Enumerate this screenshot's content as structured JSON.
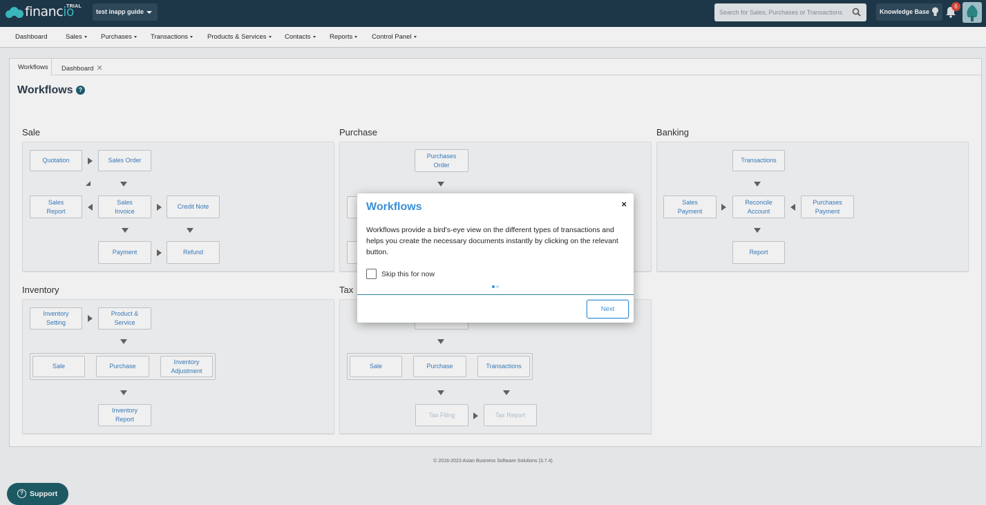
{
  "app": {
    "logo": "financio",
    "trial_label": "TRIAL",
    "company_selector": "test inapp guide",
    "search_placeholder": "Search for Sales, Purchases or Transactions",
    "knowledge_base": "Knowledge Base",
    "notification_count": "6"
  },
  "nav": [
    "Dashboard",
    "Sales",
    "Purchases",
    "Transactions",
    "Products & Services",
    "Contacts",
    "Reports",
    "Control Panel"
  ],
  "tabs": {
    "workflows": "Workflows",
    "dashboard": "Dashboard"
  },
  "page": {
    "title": "Workflows",
    "help": "?"
  },
  "sections": {
    "sale": {
      "title": "Sale",
      "quotation": "Quotation",
      "sales_order": "Sales Order",
      "sales_report": "Sales\nReport",
      "sales_invoice": "Sales\nInvoice",
      "credit_note": "Credit Note",
      "payment": "Payment",
      "refund": "Refund"
    },
    "purchase": {
      "title": "Purchase",
      "purchases_order": "Purchases\nOrder"
    },
    "banking": {
      "title": "Banking",
      "transactions": "Transactions",
      "sales_payment": "Sales\nPayment",
      "reconcile_account": "Reconcile\nAccount",
      "purchases_payment": "Purchases\nPayment",
      "report": "Report"
    },
    "inventory": {
      "title": "Inventory",
      "inventory_setting": "Inventory\nSetting",
      "product_service": "Product &\nService",
      "sale": "Sale",
      "purchase": "Purchase",
      "inventory_adjustment": "Inventory\nAdjustment",
      "inventory_report": "Inventory\nReport"
    },
    "tax": {
      "title": "Tax",
      "sale": "Sale",
      "purchase": "Purchase",
      "transactions": "Transactions",
      "tax_filing": "Tax Filing",
      "tax_report": "Tax Report"
    }
  },
  "footer": "© 2016-2023 Asian Business Software Solutions (3.7.4)",
  "support": "Support",
  "modal": {
    "title": "Workflows",
    "close": "×",
    "body": "Workflows provide a bird's-eye view on the different types of transactions and helps you create the necessary documents instantly by clicking on the relevant button.",
    "skip_label": "Skip this for now",
    "next": "Next"
  },
  "colors": {
    "topbar": "#1f3a4d",
    "accent": "#3a8fd6",
    "brand": "#3ec1c8"
  }
}
